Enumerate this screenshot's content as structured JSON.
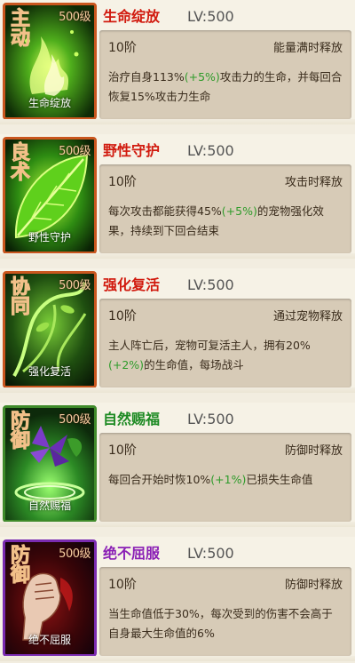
{
  "skills": [
    {
      "icon_level": "500级",
      "icon_type": "主动",
      "icon_name": "生命绽放",
      "title": "生命绽放",
      "lv": "LV:500",
      "rank": "10阶",
      "trigger": "能量满时释放",
      "desc_pre": "治疗自身113%",
      "desc_hl": "(+5%)",
      "desc_post": "攻击力的生命，并每回合恢复15%攻击力生命",
      "title_color": "#d11a0e",
      "icon_theme": "green-flame-icon"
    },
    {
      "icon_level": "500级",
      "icon_type": "良术",
      "icon_name": "野性守护",
      "title": "野性守护",
      "lv": "LV:500",
      "rank": "10阶",
      "trigger": "攻击时释放",
      "desc_pre": "每次攻击都能获得45%",
      "desc_hl": "(+5%)",
      "desc_post": "的宠物强化效果，持续到下回合结束",
      "title_color": "#d11a0e",
      "icon_theme": "leaf-icon"
    },
    {
      "icon_level": "500级",
      "icon_type": "协同",
      "icon_name": "强化复活",
      "title": "强化复活",
      "lv": "LV:500",
      "rank": "10阶",
      "trigger": "通过宠物释放",
      "desc_pre": "主人阵亡后，宠物可复活主人，拥有20%",
      "desc_hl": "(+2%)",
      "desc_post": "的生命值，每场战斗",
      "title_color": "#d11a0e",
      "icon_theme": "vine-icon"
    },
    {
      "icon_level": "500级",
      "icon_type": "防御",
      "icon_name": "自然赐福",
      "title": "自然赐福",
      "lv": "LV:500",
      "rank": "10阶",
      "trigger": "防御时释放",
      "desc_pre": "每回合开始时恢10%",
      "desc_hl": "(+1%)",
      "desc_post": "已损失生命值",
      "title_color": "#1d8a23",
      "icon_theme": "flower-icon"
    },
    {
      "icon_level": "500级",
      "icon_type": "防御",
      "icon_name": "绝不屈服",
      "title": "绝不屈服",
      "lv": "LV:500",
      "rank": "10阶",
      "trigger": "防御时释放",
      "desc_pre": "当生命值低于30%，每次受到的伤害不会高于自身最大生命值的6%",
      "desc_hl": "",
      "desc_post": "",
      "title_color": "#8a1fb5",
      "icon_theme": "fist-icon"
    }
  ]
}
